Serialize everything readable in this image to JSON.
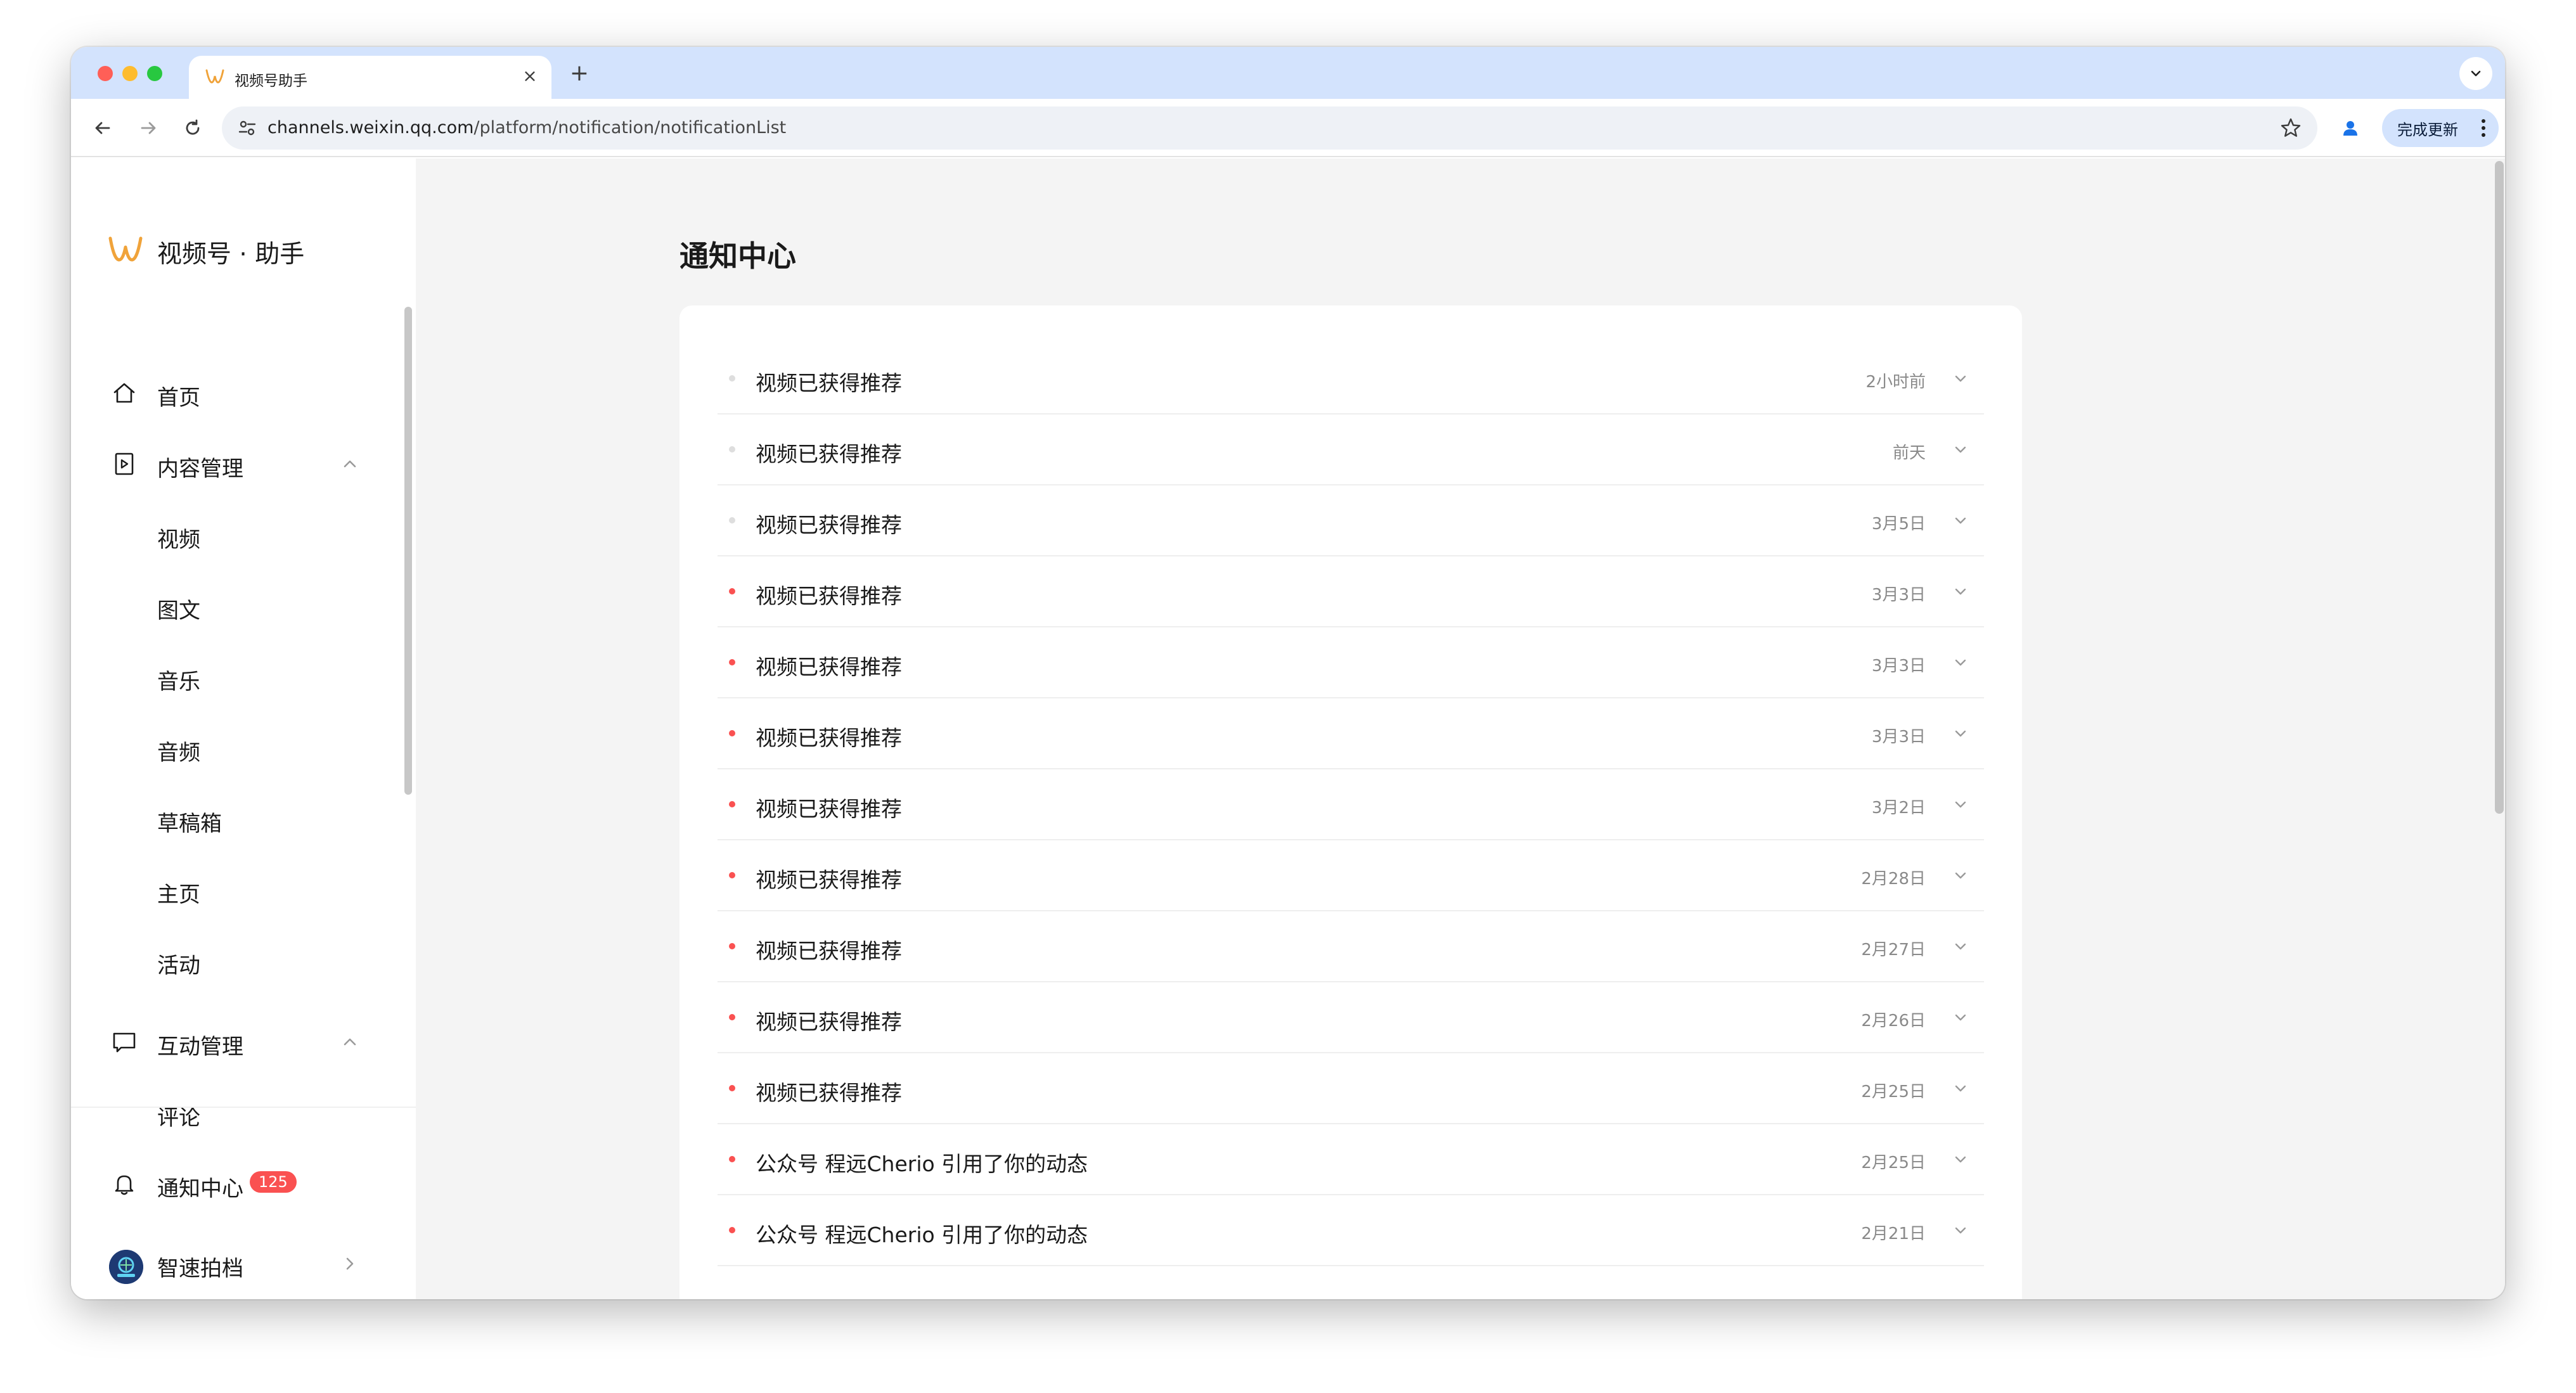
{
  "browser": {
    "tab_title": "视频号助手",
    "new_tab_label": "+",
    "tab_close_label": "×",
    "url_host": "channels.weixin.qq.com",
    "url_path": "/platform/notification/notificationList",
    "update_label": "完成更新"
  },
  "sidebar": {
    "brand": "视频号 · 助手",
    "home": "首页",
    "content_mgmt": "内容管理",
    "content_items": [
      "视频",
      "图文",
      "音乐",
      "音频",
      "草稿箱",
      "主页",
      "活动"
    ],
    "interaction_mgmt": "互动管理",
    "interaction_items": [
      "评论"
    ],
    "notifications": "通知中心",
    "notification_count": "125",
    "account_name": "智速拍档"
  },
  "main": {
    "title": "通知中心",
    "notifications": [
      {
        "title": "视频已获得推荐",
        "time": "2小时前",
        "unread": false
      },
      {
        "title": "视频已获得推荐",
        "time": "前天",
        "unread": false
      },
      {
        "title": "视频已获得推荐",
        "time": "3月5日",
        "unread": false
      },
      {
        "title": "视频已获得推荐",
        "time": "3月3日",
        "unread": true
      },
      {
        "title": "视频已获得推荐",
        "time": "3月3日",
        "unread": true
      },
      {
        "title": "视频已获得推荐",
        "time": "3月3日",
        "unread": true
      },
      {
        "title": "视频已获得推荐",
        "time": "3月2日",
        "unread": true
      },
      {
        "title": "视频已获得推荐",
        "time": "2月28日",
        "unread": true
      },
      {
        "title": "视频已获得推荐",
        "time": "2月27日",
        "unread": true
      },
      {
        "title": "视频已获得推荐",
        "time": "2月26日",
        "unread": true
      },
      {
        "title": "视频已获得推荐",
        "time": "2月25日",
        "unread": true
      },
      {
        "title": "公众号 程远Cherio 引用了你的动态",
        "time": "2月25日",
        "unread": true
      },
      {
        "title": "公众号 程远Cherio 引用了你的动态",
        "time": "2月21日",
        "unread": true
      }
    ]
  },
  "colors": {
    "tabstrip": "#d3e3fd",
    "page_bg": "#f4f4f4",
    "unread_dot": "#fa5151",
    "badge": "#fa5151",
    "brand_orange": "#f0a33a"
  }
}
